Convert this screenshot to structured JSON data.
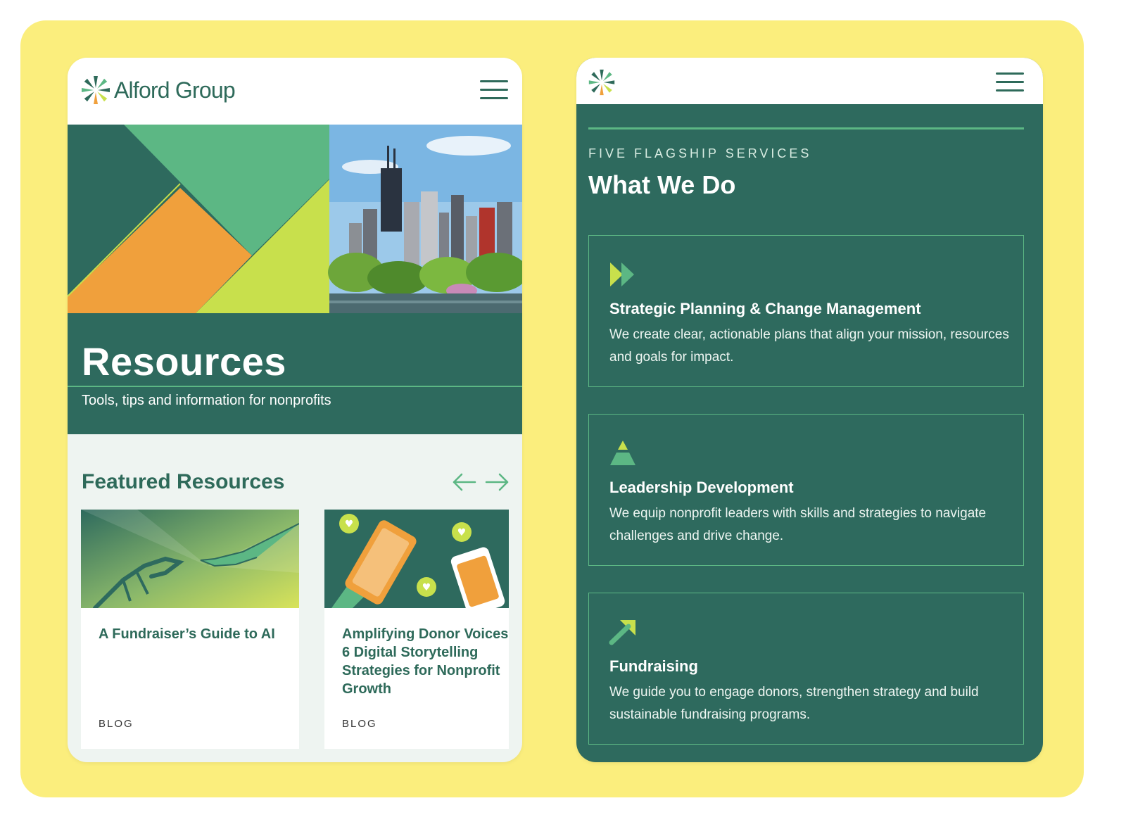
{
  "left": {
    "brand": {
      "name": "Alford Group"
    },
    "hero": {
      "title": "Resources",
      "subtitle": "Tools, tips and information for nonprofits"
    },
    "featured": {
      "title": "Featured Resources",
      "cards": [
        {
          "title": "A Fundraiser’s Guide to AI",
          "tag": "BLOG"
        },
        {
          "title_lines": [
            "Amplifying Donor Voices:",
            "6 Digital Storytelling",
            "Strategies for Nonprofit",
            "Growth"
          ],
          "tag": "BLOG"
        }
      ]
    }
  },
  "right": {
    "eyebrow": "FIVE FLAGSHIP SERVICES",
    "title": "What We Do",
    "services": [
      {
        "title": "Strategic Planning & Change Management",
        "desc": "We create clear, actionable plans that align your mission, resources and goals for impact.",
        "icon": "double-chevron-icon"
      },
      {
        "title": "Leadership Development",
        "desc": "We equip nonprofit leaders with skills and strategies to navigate challenges and drive change.",
        "icon": "pyramid-icon"
      },
      {
        "title": "Fundraising",
        "desc": "We guide you to engage donors, strengthen strategy and build sustainable fundraising programs.",
        "icon": "arrow-up-right-icon"
      }
    ]
  },
  "colors": {
    "yellow_bg": "#fbee7d",
    "dark_green": "#2e6a5e",
    "accent_green": "#5cb784",
    "lime": "#c8e04c",
    "orange": "#f0a03c"
  }
}
